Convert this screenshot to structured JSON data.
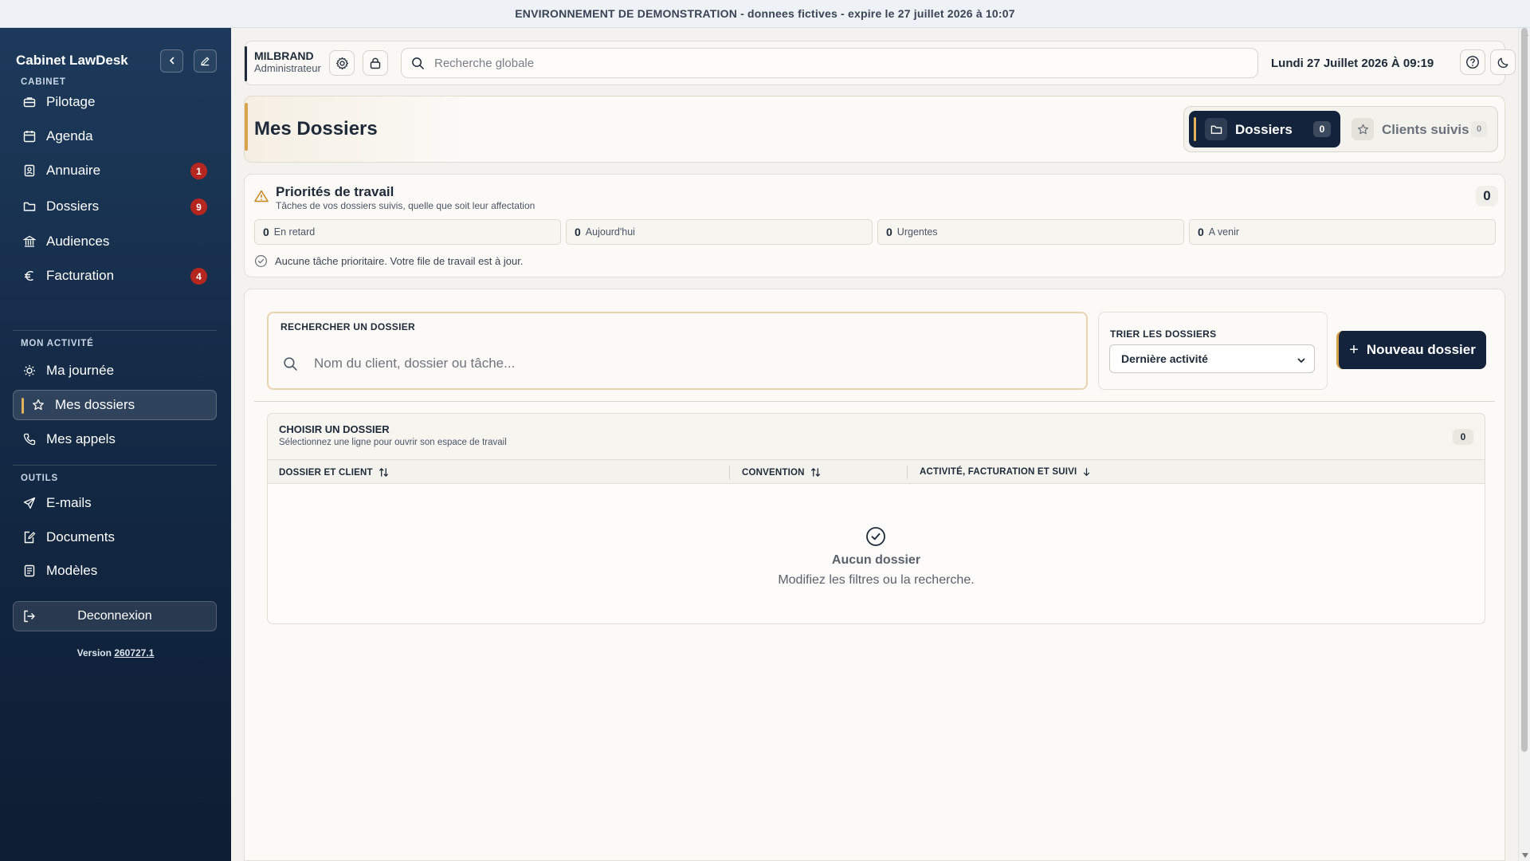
{
  "banner": {
    "text": "ENVIRONNEMENT DE DEMONSTRATION - donnees fictives - expire le 27 juillet 2026 à 10:07"
  },
  "sidebar": {
    "brand": "Cabinet LawDesk",
    "sections": {
      "cabinet": "CABINET",
      "activity": "MON ACTIVITÉ",
      "tools": "OUTILS"
    },
    "items": [
      {
        "label": "Pilotage",
        "icon": "briefcase-icon"
      },
      {
        "label": "Agenda",
        "icon": "calendar-icon"
      },
      {
        "label": "Annuaire",
        "icon": "contact-book-icon",
        "badge": "1"
      },
      {
        "label": "Dossiers",
        "icon": "folder-icon",
        "badge": "9"
      },
      {
        "label": "Audiences",
        "icon": "courthouse-icon"
      },
      {
        "label": "Facturation",
        "icon": "euro-icon",
        "badge": "4"
      },
      {
        "label": "Ma journée",
        "icon": "sun-icon"
      },
      {
        "label": "Mes dossiers",
        "icon": "star-icon",
        "active": true
      },
      {
        "label": "Mes appels",
        "icon": "phone-icon"
      },
      {
        "label": "E-mails",
        "icon": "send-icon"
      },
      {
        "label": "Documents",
        "icon": "document-edit-icon"
      },
      {
        "label": "Modèles",
        "icon": "template-icon"
      }
    ],
    "logout": "Deconnexion",
    "version_label": "Version",
    "version": "260727.1"
  },
  "topbar": {
    "user_name": "MILBRAND",
    "user_role": "Administrateur",
    "search_placeholder": "Recherche globale",
    "datetime": "Lundi 27 Juillet 2026 À 09:19"
  },
  "header": {
    "title": "Mes Dossiers",
    "tabs": [
      {
        "label": "Dossiers",
        "count": "0",
        "active": true
      },
      {
        "label": "Clients suivis",
        "count": "0"
      }
    ]
  },
  "priorities": {
    "title": "Priorités de travail",
    "subtitle": "Tâches de vos dossiers suivis, quelle que soit leur affectation",
    "total": "0",
    "stats": [
      {
        "value": "0",
        "label": "En retard"
      },
      {
        "value": "0",
        "label": "Aujourd'hui"
      },
      {
        "value": "0",
        "label": "Urgentes"
      },
      {
        "value": "0",
        "label": "A venir"
      }
    ],
    "empty_message": "Aucune tâche prioritaire. Votre file de travail est à jour."
  },
  "search": {
    "label": "RECHERCHER UN DOSSIER",
    "placeholder": "Nom du client, dossier ou tâche..."
  },
  "sort": {
    "label": "TRIER LES DOSSIERS",
    "selected": "Dernière activité"
  },
  "new_button": "Nouveau dossier",
  "list": {
    "title": "CHOISIR UN DOSSIER",
    "subtitle": "Sélectionnez une ligne pour ouvrir son espace de travail",
    "count": "0",
    "columns": [
      "DOSSIER ET CLIENT",
      "CONVENTION",
      "ACTIVITÉ, FACTURATION ET SUIVI"
    ],
    "empty_title": "Aucun dossier",
    "empty_subtitle": "Modifiez les filtres ou la recherche."
  },
  "colors": {
    "sidebar_top": "#1d3a5c",
    "sidebar_bottom": "#0d1d33",
    "accent_gold": "#d9a24c",
    "badge_red": "#b5261e",
    "primary_dark": "#13233b"
  }
}
